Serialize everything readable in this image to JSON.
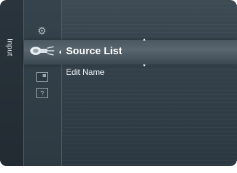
{
  "menu": {
    "section_label": "Input",
    "items": [
      {
        "label": "Source List",
        "selected": true
      },
      {
        "label": "Edit Name",
        "selected": false
      }
    ]
  },
  "icons": {
    "settings": "gear-icon",
    "input": "input-plug-icon",
    "picture": "picture-in-picture-icon",
    "help": "help-icon",
    "help_glyph": "?"
  },
  "colors": {
    "panel_top": "#3e4a54",
    "panel_bottom": "#2c3841",
    "highlight": "#5a666f",
    "text": "#ffffff"
  }
}
